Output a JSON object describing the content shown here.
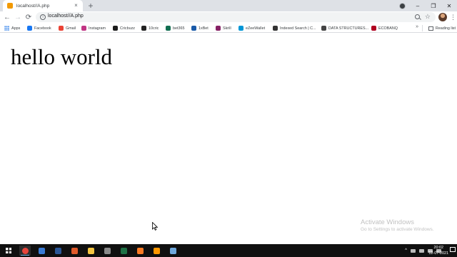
{
  "browser": {
    "tab": {
      "title": "localhost//A.php",
      "close_glyph": "×"
    },
    "new_tab_glyph": "+",
    "window_controls": {
      "minimize": "–",
      "restore": "❐",
      "close": "✕"
    },
    "address": {
      "url": "localhost//A.php"
    },
    "nav": {
      "back": "←",
      "forward": "→",
      "reload": "⟳"
    },
    "star_glyph": "☆",
    "menu_glyph": "⋮"
  },
  "bookmarks": {
    "items": [
      {
        "label": "Apps",
        "icon": "apps-grid-icon",
        "color": "#1a73e8"
      },
      {
        "label": "Facebook",
        "icon": "facebook-icon",
        "color": "#1877f2"
      },
      {
        "label": "Gmail",
        "icon": "gmail-icon",
        "color": "#ea4335"
      },
      {
        "label": "Instagram",
        "icon": "instagram-icon",
        "color": "#c13584"
      },
      {
        "label": "Cricbuzz",
        "icon": "cricbuzz-icon",
        "color": "#1c1c1c"
      },
      {
        "label": "10cric",
        "icon": "10cric-icon",
        "color": "#222222"
      },
      {
        "label": "bet365",
        "icon": "bet365-icon",
        "color": "#126e51"
      },
      {
        "label": "1xBet",
        "icon": "1xbet-icon",
        "color": "#1a5aa8"
      },
      {
        "label": "Skrill",
        "icon": "skrill-icon",
        "color": "#862165"
      },
      {
        "label": "eZeeWallet",
        "icon": "ezeewallet-icon",
        "color": "#0096d6"
      },
      {
        "label": "Indexed Search | C...",
        "icon": "indexed-search-icon",
        "color": "#333333"
      },
      {
        "label": "DATA STRUCTURES...",
        "icon": "data-structures-icon",
        "color": "#444444"
      },
      {
        "label": "ECOBANQ",
        "icon": "ecobanq-icon",
        "color": "#b00020"
      }
    ],
    "more_glyph": "»",
    "reading_list": "Reading list"
  },
  "page": {
    "heading": "hello world"
  },
  "watermark": {
    "title": "Activate Windows",
    "subtitle": "Go to Settings to activate Windows."
  },
  "taskbar": {
    "apps": [
      {
        "name": "chrome",
        "color": "#e8453c",
        "active": true
      },
      {
        "name": "photos",
        "color": "#3a7bd5",
        "active": false
      },
      {
        "name": "word",
        "color": "#2b5797",
        "active": false
      },
      {
        "name": "media",
        "color": "#e05a2b",
        "active": false
      },
      {
        "name": "files",
        "color": "#f4c542",
        "active": false
      },
      {
        "name": "settings",
        "color": "#8a8a8a",
        "active": false
      },
      {
        "name": "excel",
        "color": "#1e7145",
        "active": false
      },
      {
        "name": "xampp",
        "color": "#fb7a24",
        "active": false
      },
      {
        "name": "sublime",
        "color": "#ff9800",
        "active": false
      },
      {
        "name": "notepad",
        "color": "#6fa8dc",
        "active": false
      }
    ],
    "clock": {
      "time": "20:02",
      "date": "12-07-2021"
    }
  }
}
